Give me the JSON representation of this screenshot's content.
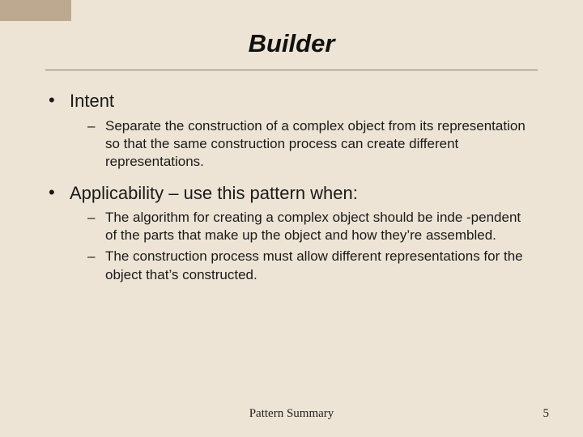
{
  "title": "Builder",
  "bullets": [
    {
      "label": "Intent",
      "subs": [
        "Separate the construction of a complex object from its representation so that the same construction process can create different representations."
      ]
    },
    {
      "label": "Applicability – use this pattern when:",
      "subs": [
        "The algorithm for creating a complex object should be inde -pendent of the parts that make up the object and how they’re assembled.",
        "The construction process must allow different representations for the object that’s constructed."
      ]
    }
  ],
  "footer": "Pattern Summary",
  "page_number": "5",
  "glyphs": {
    "bullet": "•",
    "dash": "–"
  }
}
